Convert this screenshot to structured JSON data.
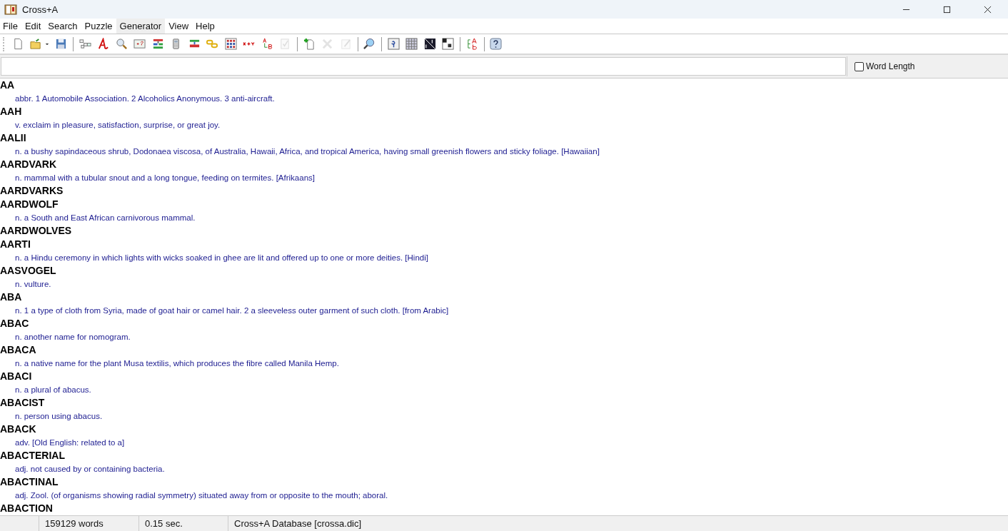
{
  "window": {
    "title": "Cross+A"
  },
  "menu": [
    {
      "label": "File",
      "selected": false
    },
    {
      "label": "Edit",
      "selected": false
    },
    {
      "label": "Search",
      "selected": false
    },
    {
      "label": "Puzzle",
      "selected": false
    },
    {
      "label": "Generator",
      "selected": true
    },
    {
      "label": "View",
      "selected": false
    },
    {
      "label": "Help",
      "selected": false
    }
  ],
  "toolbar": [
    {
      "kind": "new",
      "disabled": false
    },
    {
      "kind": "open",
      "disabled": false
    },
    {
      "kind": "dropdown",
      "disabled": false
    },
    {
      "kind": "save",
      "disabled": false
    },
    {
      "kind": "separator"
    },
    {
      "kind": "structure",
      "disabled": false
    },
    {
      "kind": "letter",
      "disabled": false
    },
    {
      "kind": "find",
      "disabled": false
    },
    {
      "kind": "pattern",
      "disabled": false
    },
    {
      "kind": "bars",
      "disabled": false
    },
    {
      "kind": "device",
      "disabled": false
    },
    {
      "kind": "branch",
      "disabled": false
    },
    {
      "kind": "link",
      "disabled": false
    },
    {
      "kind": "grid",
      "disabled": false
    },
    {
      "kind": "formula",
      "disabled": false
    },
    {
      "kind": "convert",
      "disabled": false
    },
    {
      "kind": "check",
      "disabled": true
    },
    {
      "kind": "separator"
    },
    {
      "kind": "add",
      "disabled": false
    },
    {
      "kind": "delete",
      "disabled": true
    },
    {
      "kind": "edit",
      "disabled": true
    },
    {
      "kind": "separator"
    },
    {
      "kind": "zoom",
      "disabled": false
    },
    {
      "kind": "separator"
    },
    {
      "kind": "numbers",
      "disabled": false
    },
    {
      "kind": "lattice",
      "disabled": false
    },
    {
      "kind": "clue",
      "disabled": false
    },
    {
      "kind": "blocks",
      "disabled": false
    },
    {
      "kind": "separator"
    },
    {
      "kind": "swap",
      "disabled": false
    },
    {
      "kind": "separator"
    },
    {
      "kind": "help",
      "disabled": false
    }
  ],
  "word_length": {
    "label": "Word Length",
    "checked": false
  },
  "entries": [
    {
      "word": "AA",
      "definition": "abbr. 1 Automobile Association. 2 Alcoholics Anonymous. 3 anti-aircraft."
    },
    {
      "word": "AAH",
      "definition": "v. exclaim in pleasure, satisfaction, surprise, or great joy."
    },
    {
      "word": "AALII",
      "definition": "n. a bushy sapindaceous shrub, Dodonaea viscosa, of Australia, Hawaii, Africa, and tropical America, having small greenish flowers and sticky foliage. [Hawaiian]"
    },
    {
      "word": "AARDVARK",
      "definition": "n. mammal with a tubular snout and a long tongue, feeding on termites. [Afrikaans]"
    },
    {
      "word": "AARDVARKS"
    },
    {
      "word": "AARDWOLF",
      "definition": "n. a South and East African carnivorous mammal."
    },
    {
      "word": "AARDWOLVES"
    },
    {
      "word": "AARTI",
      "definition": "n. a Hindu ceremony in which lights with wicks soaked in ghee are lit and offered up to one or more deities. [Hindi]"
    },
    {
      "word": "AASVOGEL",
      "definition": "n. vulture."
    },
    {
      "word": "ABA",
      "definition": "n. 1 a type of cloth from Syria, made of goat hair or camel hair. 2 a sleeveless outer garment of such cloth. [from Arabic]"
    },
    {
      "word": "ABAC",
      "definition": "n. another name for nomogram."
    },
    {
      "word": "ABACA",
      "definition": "n. a native name for the plant Musa textilis, which produces the fibre called Manila Hemp."
    },
    {
      "word": "ABACI",
      "definition": "n. a plural of abacus."
    },
    {
      "word": "ABACIST",
      "definition": "n. person using abacus."
    },
    {
      "word": "ABACK",
      "definition": "adv. [Old English: related to a]"
    },
    {
      "word": "ABACTERIAL",
      "definition": "adj. not caused by or containing bacteria."
    },
    {
      "word": "ABACTINAL",
      "definition": "adj. Zool. (of organisms showing radial symmetry) situated away from or opposite to the mouth; aboral."
    },
    {
      "word": "ABACTION"
    }
  ],
  "status_bar": [
    "159129 words",
    "0.15 sec.",
    "Cross+A Database [crossa.dic]"
  ]
}
